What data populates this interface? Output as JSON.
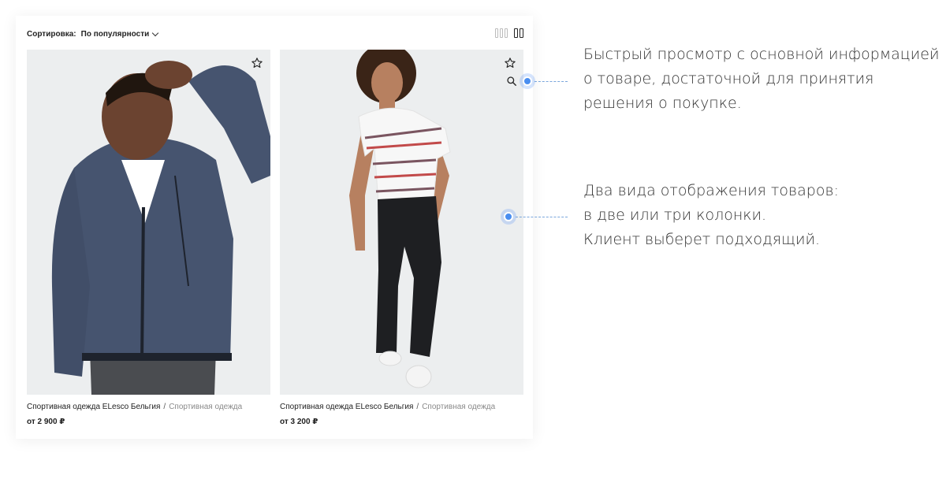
{
  "toolbar": {
    "sort_label": "Сортировка:",
    "sort_value": "По популярности",
    "view_options": [
      "three-columns-icon",
      "two-columns-icon"
    ],
    "active_view": "two-columns"
  },
  "products": [
    {
      "breadcrumb_main": "Спортивная одежда ELesco Бельгия",
      "breadcrumb_sep": "/",
      "breadcrumb_category": "Спортивная одежда",
      "price": "от 2 900 ₽",
      "icons": [
        "star-icon"
      ]
    },
    {
      "breadcrumb_main": "Спортивная одежда ELesco Бельгия",
      "breadcrumb_sep": "/",
      "breadcrumb_category": "Спортивная одежда",
      "price": "от 3 200 ₽",
      "icons": [
        "star-icon",
        "search-icon"
      ]
    }
  ],
  "annotations": {
    "quick_view": {
      "line1": "Быстрый просмотр с основной информацией",
      "line2": "о товаре, достаточной для принятия",
      "line3": "решения о покупке."
    },
    "view_modes": {
      "line1": "Два вида отображения товаров:",
      "line2": "в две или три колонки.",
      "line3": "Клиент выберет подходящий."
    }
  },
  "colors": {
    "accent": "#4a8ef0",
    "photo_bg": "#eef0f1",
    "muted_text": "#8a8a8a"
  }
}
